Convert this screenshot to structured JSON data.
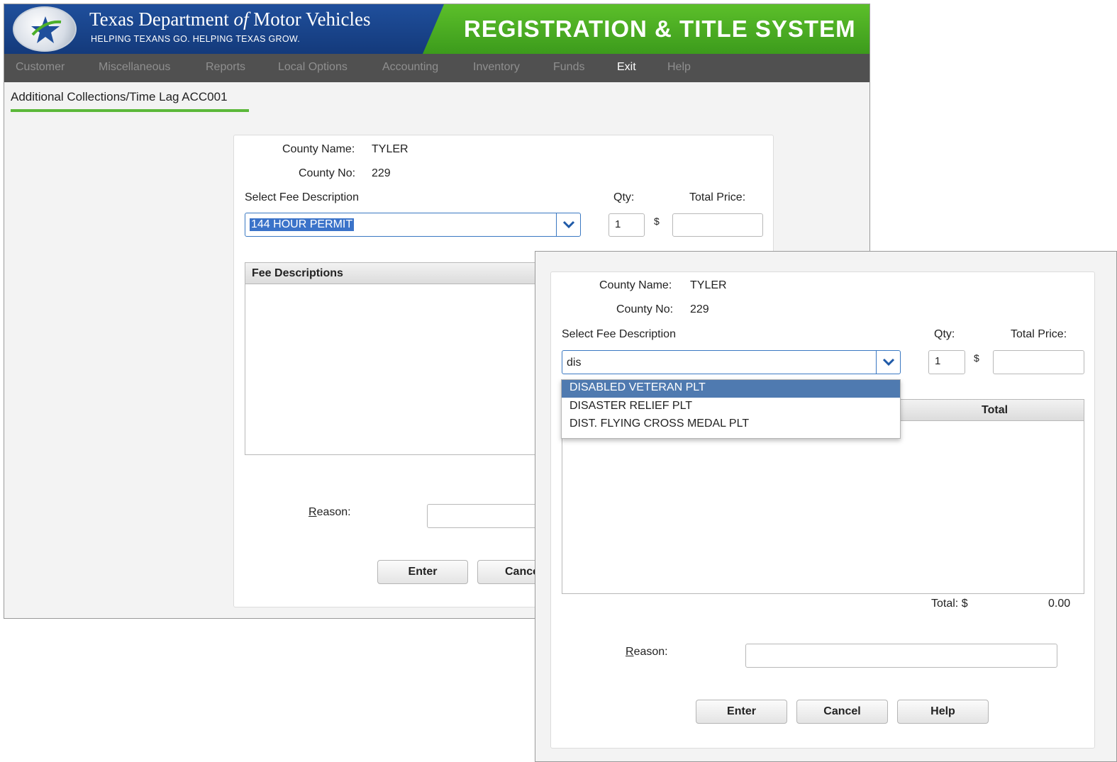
{
  "app": {
    "agency": "Texas Department",
    "agency_of": "of",
    "agency_rest": "Motor Vehicles",
    "tagline": "HELPING TEXANS GO. HELPING TEXAS GROW.",
    "system_title": "REGISTRATION & TITLE SYSTEM"
  },
  "menu": [
    "Customer",
    "Miscellaneous",
    "Reports",
    "Local Options",
    "Accounting",
    "Inventory",
    "Funds",
    "Exit",
    "Help"
  ],
  "page_heading": "Additional Collections/Time Lag ACC001",
  "back_form": {
    "county_name_label": "County Name:",
    "county_name": "TYLER",
    "county_no_label": "County No:",
    "county_no": "229",
    "fee_select_label": "Select Fee Description",
    "fee_selected": "144 HOUR PERMIT",
    "qty_label": "Qty:",
    "qty": "1",
    "total_price_label": "Total Price:",
    "dollar": "$",
    "grid_header": "Fee Descriptions",
    "reason_label_first": "R",
    "reason_label_rest": "eason:",
    "enter_label": "Enter",
    "cancel_label": "Cance"
  },
  "front_form": {
    "county_name_label": "County Name:",
    "county_name": "TYLER",
    "county_no_label": "County No:",
    "county_no": "229",
    "fee_select_label": "Select Fee Description",
    "fee_input": "dis",
    "qty_label": "Qty:",
    "qty": "1",
    "total_price_label": "Total Price:",
    "dollar": "$",
    "grid_header_total": "Total",
    "dropdown_options": [
      "DISABLED VETERAN PLT",
      "DISASTER RELIEF PLT",
      "DIST. FLYING CROSS MEDAL PLT"
    ],
    "total_label": "Total: $",
    "total_value": "0.00",
    "reason_label_first": "R",
    "reason_label_rest": "eason:",
    "enter_label": "Enter",
    "cancel_label": "Cancel",
    "help_label": "Help"
  },
  "colors": {
    "banner_blue": "#1f4f9c",
    "banner_green": "#4caf2a",
    "menubar": "#505050",
    "selection": "#4f7ab0"
  }
}
